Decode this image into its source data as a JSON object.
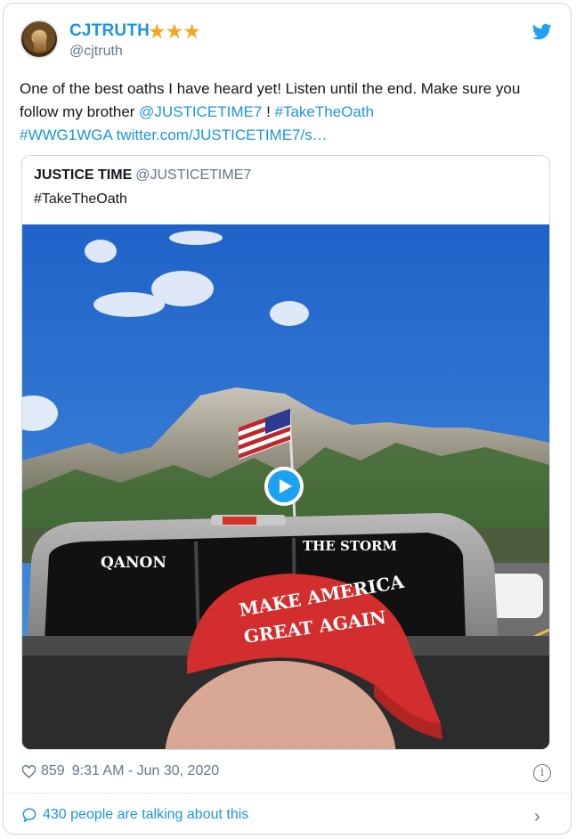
{
  "author": {
    "name": "CJTRUTH",
    "stars": "★★★",
    "handle": "@cjtruth"
  },
  "tweet": {
    "text_before": "One of the best oaths I have heard yet!  Listen until the end.  Make sure you follow my brother ",
    "mention": "@JUSTICETIME7",
    "text_mid": " ! ",
    "hashtag1": "#TakeTheOath",
    "hashtag2": "#WWG1WGA",
    "url": "twitter.com/JUSTICETIME7/s…"
  },
  "quoted": {
    "name": "JUSTICE TIME",
    "handle": "@JUSTICETIME7",
    "text": "#TakeTheOath",
    "media": {
      "window_left": "QANON",
      "window_right": "THE STORM",
      "hat_line1": "MAKE AMERICA",
      "hat_line2": "GREAT AGAIN"
    }
  },
  "footer": {
    "likes": "859",
    "timestamp": "9:31 AM - Jun 30, 2020",
    "talking": "430 people are talking about this"
  },
  "icons": {
    "bird": "twitter-bird-icon",
    "heart": "heart-icon",
    "info": "info-icon",
    "bubble": "comment-bubble-icon",
    "chevron": "chevron-right-icon",
    "play": "play-icon"
  },
  "colors": {
    "accent": "#1b95e0",
    "star": "#f5a623",
    "muted": "#657786"
  }
}
